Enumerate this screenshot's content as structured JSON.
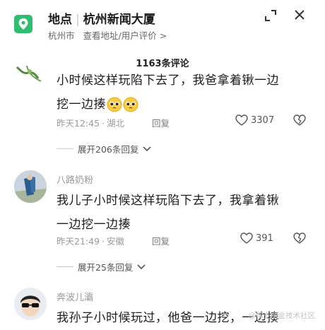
{
  "header": {
    "title_place": "地点",
    "title_name": "杭州新闻大厦",
    "city": "杭州市",
    "links": "查看地址/用户评价 >",
    "icon": "location-pin-icon"
  },
  "comment_count": "1163条评论",
  "comments": [
    {
      "text_line1": "小时候这样玩陷下去了，我爸拿着锹一边",
      "text_line2": "挖一边揍",
      "emojis": [
        "pleading-face-emoji",
        "pleading-face-emoji"
      ],
      "time": "昨天12:45",
      "location": "湖北",
      "reply": "回复",
      "likes": "3307",
      "expand": "展开206条回复"
    },
    {
      "username": "八路奶粉",
      "text_line1": "我儿子小时候这样玩陷下去了，我拿着锹",
      "text_line2": "一边挖一边揍",
      "time": "昨天21:49",
      "location": "安徽",
      "reply": "回复",
      "likes": "391",
      "expand": "展开25条回复"
    },
    {
      "username": "奔波儿灞",
      "text_line1": "我孙子小时候玩过，他爸一边挖，一边揍"
    }
  ],
  "watermark": "@稀土掘金技术社区",
  "colors": {
    "accent_green": "#2fbd6f",
    "meta_gray": "#9a9a9a"
  }
}
